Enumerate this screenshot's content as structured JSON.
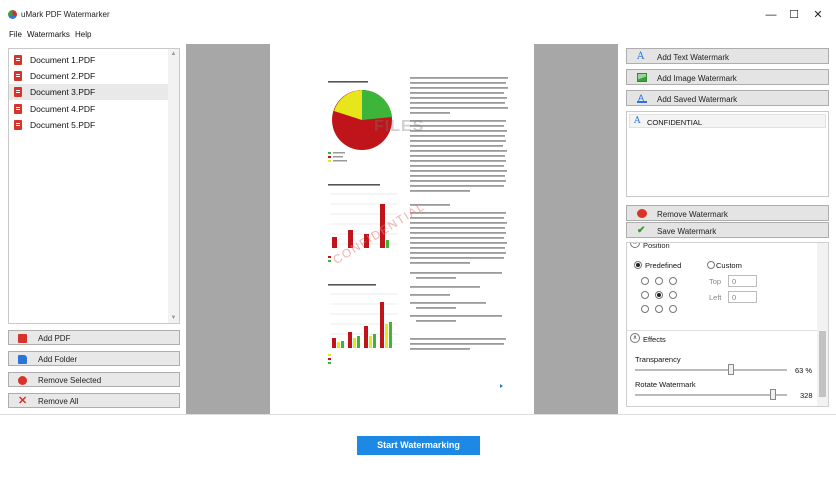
{
  "window": {
    "title": "uMark PDF Watermarker",
    "controls": {
      "minimize": "—",
      "maximize": "☐",
      "close": "✕"
    }
  },
  "menu": [
    "File",
    "Watermarks",
    "Help"
  ],
  "documents": [
    {
      "label": "Document 1.PDF",
      "selected": false
    },
    {
      "label": "Document 2.PDF",
      "selected": false
    },
    {
      "label": "Document 3.PDF",
      "selected": true
    },
    {
      "label": "Document 4.PDF",
      "selected": false
    },
    {
      "label": "Document 5.PDF",
      "selected": false
    }
  ],
  "left_buttons": {
    "add_pdf": "Add PDF",
    "add_folder": "Add Folder",
    "remove_selected": "Remove Selected",
    "remove_all": "Remove All"
  },
  "right_buttons": {
    "add_text": "Add Text Watermark",
    "add_image": "Add Image Watermark",
    "add_saved": "Add Saved Watermark",
    "remove": "Remove Watermark",
    "save": "Save Watermark"
  },
  "watermarks": [
    {
      "label": "CONFIDENTIAL",
      "icon": "text-watermark-icon"
    }
  ],
  "settings": {
    "position_header": "Position",
    "predefined_label": "Predefined",
    "custom_label": "Custom",
    "top_label": "Top",
    "left_label": "Left",
    "top_value": "0",
    "left_value": "0",
    "selected_position": "center",
    "effects_header": "Effects",
    "transparency_label": "Transparency",
    "transparency_value": "63 %",
    "transparency_fraction": 0.63,
    "rotate_label": "Rotate Watermark",
    "rotate_value": "328",
    "rotate_fraction": 0.911
  },
  "preview": {
    "watermark_text": "CONFIDENTIAL",
    "overlay_text": "FILES"
  },
  "start_button": "Start Watermarking",
  "colors": {
    "accent": "#1e88e5",
    "pdf_red": "#d9322b",
    "chart_red": "#c0141b",
    "chart_green": "#3db53a",
    "chart_yellow": "#e6e61a",
    "watermark": "#e87b7b"
  }
}
